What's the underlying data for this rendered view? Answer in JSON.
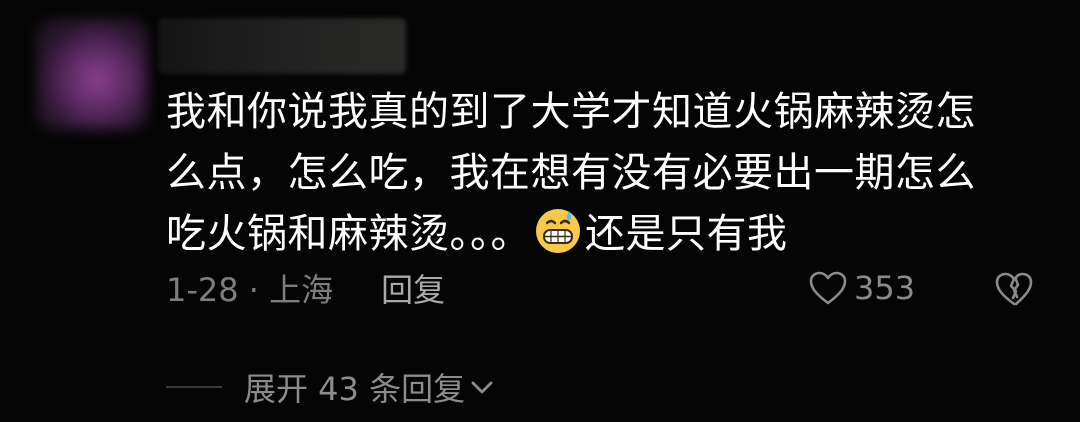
{
  "comment": {
    "username": "",
    "text_lines": [
      "我和你说我真的到了大学才知道火锅麻辣烫怎",
      "么点，怎么吃，我在想有没有必要出一期怎么",
      "吃火锅和麻辣烫。。。",
      "还是只有我"
    ],
    "emoji": "grinning-sweat-emoji",
    "date_location": "1-28 · 上海",
    "reply_label": "回复",
    "like_count": "353",
    "expand_label": "展开 43 条回复"
  },
  "icons": {
    "like": "heart-outline-icon",
    "dislike": "broken-heart-icon",
    "expand": "chevron-down-icon"
  },
  "colors": {
    "background": "#050505",
    "text": "#ffffff",
    "meta": "#7d7d7d",
    "action": "#a9a9a9"
  }
}
